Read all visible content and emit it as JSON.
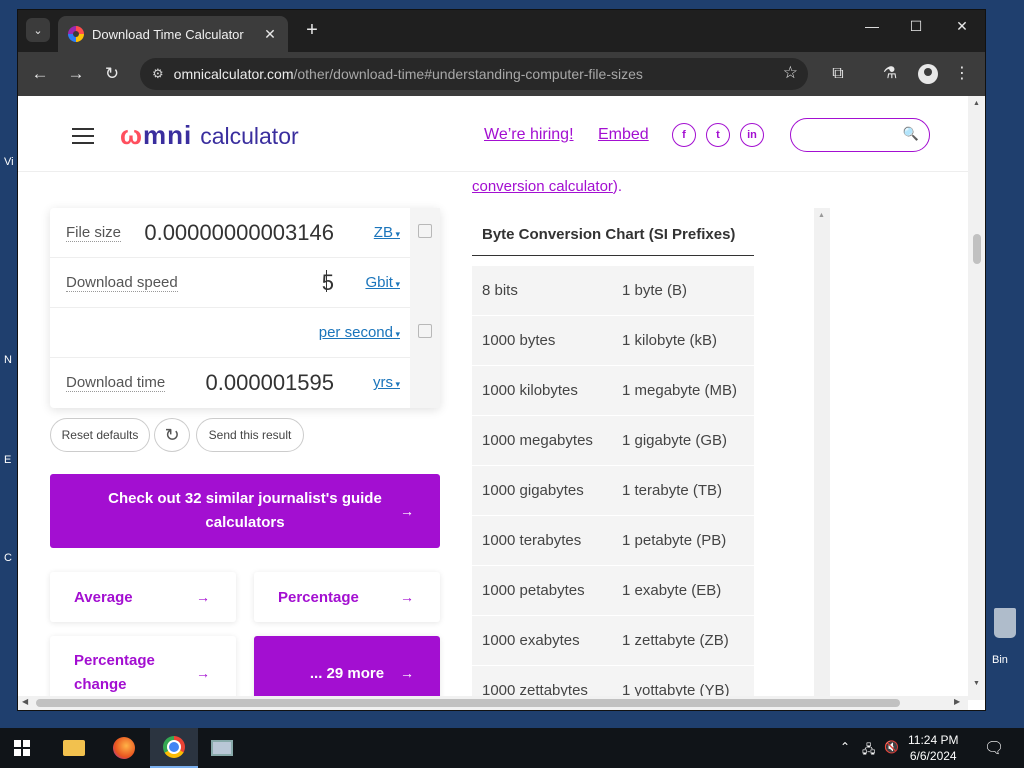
{
  "browser": {
    "tab_title": "Download Time Calculator",
    "tab_close": "✕",
    "new_tab": "+",
    "url_host": "omnicalculator.com",
    "url_path": "/other/download-time#understanding-computer-file-sizes"
  },
  "header": {
    "logo_omni": "mni",
    "logo_o": "ω",
    "logo_calculator": "calculator",
    "hiring_link": "We’re hiring!",
    "embed_link": "Embed",
    "social": [
      "f",
      "t",
      "in"
    ],
    "search_placeholder": ""
  },
  "prev_text": {
    "link": "conversion calculator",
    "tail": ")."
  },
  "calculator": {
    "rows": [
      {
        "label": "File size",
        "value": "0.00000000003146",
        "unit": "ZB"
      },
      {
        "label": "Download speed",
        "value": "5",
        "unit": "Gbit"
      },
      {
        "label": "",
        "value": "",
        "unit": "per second"
      },
      {
        "label": "Download time",
        "value": "0.000001595",
        "unit": "yrs"
      }
    ],
    "reset_label": "Reset defaults",
    "reload_icon": "↻",
    "share_label": "Send this result"
  },
  "cta": {
    "label": "Check out 32 similar journalist's guide calculators",
    "arrow": "→"
  },
  "related": [
    {
      "label": "Average"
    },
    {
      "label": "Percentage"
    },
    {
      "label": "Percentage change"
    },
    {
      "label": "... 29 more"
    }
  ],
  "table": {
    "title": "Byte Conversion Chart (SI Prefixes)",
    "rows": [
      [
        "8 bits",
        "1 byte (B)"
      ],
      [
        "1000 bytes",
        "1 kilobyte (kB)"
      ],
      [
        "1000 kilobytes",
        "1 megabyte (MB)"
      ],
      [
        "1000 megabytes",
        "1 gigabyte (GB)"
      ],
      [
        "1000 gigabytes",
        "1 terabyte (TB)"
      ],
      [
        "1000 terabytes",
        "1 petabyte (PB)"
      ],
      [
        "1000 petabytes",
        "1 exabyte (EB)"
      ],
      [
        "1000 exabytes",
        "1 zettabyte (ZB)"
      ],
      [
        "1000 zettabytes",
        "1 yottabyte (YB)"
      ]
    ]
  },
  "desktop": {
    "recycle_label": "Bin",
    "left_letters": [
      "Vi",
      "N",
      "E",
      "C"
    ]
  },
  "taskbar": {
    "time": "11:24 PM",
    "date": "6/6/2024"
  },
  "colors": {
    "accent": "#a30fd1",
    "link_blue": "#1b75bb",
    "brand_navy": "#3a2e9e"
  }
}
